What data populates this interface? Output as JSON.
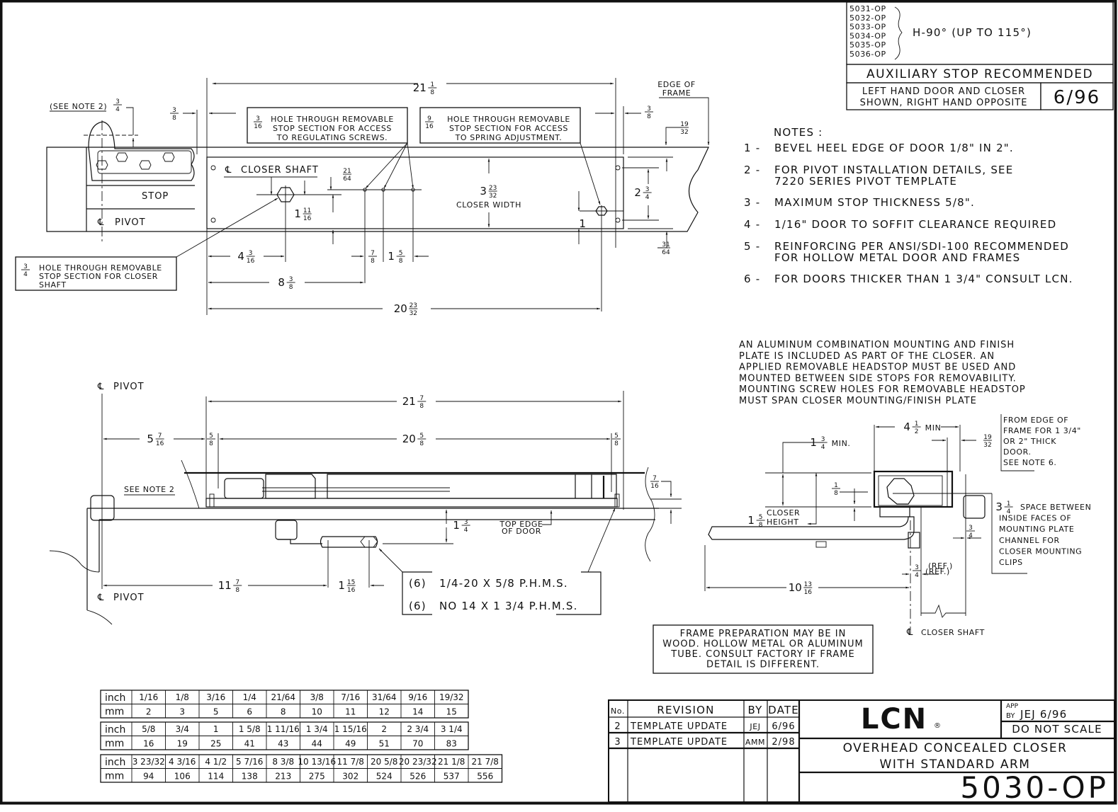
{
  "document": {
    "brand": "LCN",
    "brand_mark": "®",
    "model_number": "5030-OP",
    "title_line1": "OVERHEAD CONCEALED CLOSER",
    "title_line2": "WITH STANDARD ARM",
    "approved_by_label": "APP BY",
    "approved_by_value": "JEJ 6/96",
    "scale_note": "DO NOT SCALE"
  },
  "models_box": {
    "models": [
      "5031-OP",
      "5032-OP",
      "5033-OP",
      "5034-OP",
      "5035-OP",
      "5036-OP"
    ],
    "hold_open": "H-90° (UP TO 115°)",
    "auxiliary": "AUXILIARY STOP RECOMMENDED",
    "hand_note_line1": "LEFT HAND DOOR AND CLOSER",
    "hand_note_line2": "SHOWN, RIGHT HAND OPPOSITE",
    "date": "6/96"
  },
  "notes": {
    "heading": "NOTES :",
    "items": [
      {
        "num": "1 -",
        "lines": [
          "BEVEL HEEL EDGE OF DOOR 1/8\" IN 2\"."
        ]
      },
      {
        "num": "2 -",
        "lines": [
          "FOR PIVOT INSTALLATION DETAILS, SEE",
          "7220 SERIES PIVOT TEMPLATE"
        ]
      },
      {
        "num": "3 -",
        "lines": [
          "MAXIMUM STOP THICKNESS 5/8\"."
        ]
      },
      {
        "num": "4 -",
        "lines": [
          "1/16\" DOOR TO SOFFIT CLEARANCE REQUIRED"
        ]
      },
      {
        "num": "5 -",
        "lines": [
          "REINFORCING PER ANSI/SDI-100 RECOMMENDED",
          "FOR HOLLOW METAL DOOR AND FRAMES"
        ]
      },
      {
        "num": "6 -",
        "lines": [
          "FOR DOORS THICKER THAN 1 3/4\" CONSULT LCN."
        ]
      }
    ]
  },
  "aluminum_note": [
    "AN ALUMINUM COMBINATION MOUNTING AND FINISH",
    "PLATE IS INCLUDED AS PART OF THE CLOSER. AN",
    "APPLIED REMOVABLE HEADSTOP MUST BE USED AND",
    "MOUNTED BETWEEN SIDE STOPS FOR REMOVABILITY.",
    "MOUNTING SCREW HOLES FOR REMOVABLE HEADSTOP",
    "MUST SPAN CLOSER MOUNTING/FINISH PLATE"
  ],
  "frame_prep_note": [
    "FRAME PREPARATION MAY BE IN",
    "WOOD. HOLLOW METAL OR ALUMINUM",
    "TUBE. CONSULT FACTORY IF FRAME",
    "DETAIL IS DIFFERENT."
  ],
  "top_view": {
    "see_note_2": "(SEE NOTE 2)",
    "stop_label": "STOP",
    "pivot_label": "PIVOT",
    "cl_symbol": "℄",
    "closer_shaft_label": "CLOSER SHAFT",
    "closer_width_label": "CLOSER WIDTH",
    "edge_of_frame": [
      "EDGE OF",
      "FRAME"
    ],
    "callout_regulating": {
      "size": "3/16",
      "lines": [
        "HOLE THROUGH REMOVABLE",
        "STOP SECTION FOR ACCESS",
        "TO REGULATING SCREWS."
      ]
    },
    "callout_spring": {
      "size": "9/16",
      "lines": [
        "HOLE THROUGH REMOVABLE",
        "STOP SECTION FOR ACCESS",
        "TO SPRING ADJUSTMENT."
      ]
    },
    "callout_shaft": {
      "size": "3/4",
      "lines": [
        "HOLE THROUGH REMOVABLE",
        "STOP SECTION FOR CLOSER",
        "SHAFT"
      ]
    },
    "dims": {
      "overall_top": {
        "whole": "21",
        "num": "1",
        "den": "8"
      },
      "see_note_dim": {
        "whole": "",
        "num": "3",
        "den": "4"
      },
      "left_offset": {
        "whole": "",
        "num": "3",
        "den": "8"
      },
      "right_offset": {
        "whole": "",
        "num": "3",
        "den": "8"
      },
      "frame_19_32": {
        "whole": "",
        "num": "19",
        "den": "32"
      },
      "hole_21_64": {
        "whole": "",
        "num": "21",
        "den": "64"
      },
      "shaft_height": {
        "whole": "1",
        "num": "11",
        "den": "16"
      },
      "closer_width": {
        "whole": "3",
        "num": "23",
        "den": "32"
      },
      "plate_2_3_4": {
        "whole": "2",
        "num": "3",
        "den": "4"
      },
      "spring_1": {
        "whole": "1",
        "num": "",
        "den": ""
      },
      "frame_31_64": {
        "whole": "",
        "num": "31",
        "den": "64"
      },
      "shaft_4_3_16": {
        "whole": "4",
        "num": "3",
        "den": "16"
      },
      "reg_7_8": {
        "whole": "",
        "num": "7",
        "den": "8"
      },
      "reg_1_5_8": {
        "whole": "1",
        "num": "5",
        "den": "8"
      },
      "reg_8_3_8": {
        "whole": "8",
        "num": "3",
        "den": "8"
      },
      "spring_20_23_32": {
        "whole": "20",
        "num": "23",
        "den": "32"
      }
    }
  },
  "elevation_view": {
    "pivot_label": "PIVOT",
    "see_note_2": "SEE NOTE 2",
    "top_edge_of_door": [
      "TOP EDGE",
      "OF DOOR"
    ],
    "screws": [
      {
        "qty": "(6)",
        "spec": "1/4-20 X 5/8   P.H.M.S."
      },
      {
        "qty": "(6)",
        "spec": "NO 14 X 1 3/4   P.H.M.S."
      }
    ],
    "dims": {
      "overall": {
        "whole": "21",
        "num": "7",
        "den": "8"
      },
      "inner": {
        "whole": "20",
        "num": "5",
        "den": "8"
      },
      "pivot_offset": {
        "whole": "5",
        "num": "7",
        "den": "16"
      },
      "left_5_8": {
        "whole": "",
        "num": "5",
        "den": "8"
      },
      "right_5_8": {
        "whole": "",
        "num": "5",
        "den": "8"
      },
      "clearance_7_16": {
        "whole": "",
        "num": "7",
        "den": "16"
      },
      "arm_drop": {
        "whole": "1",
        "num": "3",
        "den": "4"
      },
      "pivot_to_arm": {
        "whole": "11",
        "num": "7",
        "den": "8"
      },
      "arm_1_15_16": {
        "whole": "1",
        "num": "15",
        "den": "16"
      }
    }
  },
  "section_view": {
    "min_1_3_4": {
      "whole": "1",
      "num": "3",
      "den": "4",
      "suffix": "MIN."
    },
    "min_4_1_2": {
      "whole": "4",
      "num": "1",
      "den": "2",
      "suffix": "MIN"
    },
    "frame_19_32": {
      "whole": "",
      "num": "19",
      "den": "32"
    },
    "frame_note": [
      "FROM EDGE OF",
      "FRAME FOR 1 3/4\"",
      "OR 2\" THICK",
      "DOOR.",
      "SEE NOTE 6."
    ],
    "gap_1_8": {
      "whole": "",
      "num": "1",
      "den": "8"
    },
    "closer_height": {
      "whole": "1",
      "num": "5",
      "den": "8",
      "label1": "CLOSER",
      "label2": "HEIGHT"
    },
    "space_note": {
      "whole": "3",
      "num": "1",
      "den": "4",
      "lines": [
        "SPACE BETWEEN",
        "INSIDE FACES OF",
        "MOUNTING PLATE",
        "CHANNEL FOR",
        "CLOSER MOUNTING",
        "CLIPS"
      ]
    },
    "clip_3_4": {
      "whole": "",
      "num": "3",
      "den": "4"
    },
    "ref_3_4": {
      "whole": "",
      "num": "3",
      "den": "4",
      "suffix": "(REF.)"
    },
    "arm_length": {
      "whole": "10",
      "num": "13",
      "den": "16"
    },
    "closer_shaft_label": "CLOSER SHAFT"
  },
  "conversion_tables": [
    {
      "row_labels": [
        "inch",
        "mm"
      ],
      "inch": [
        "1/16",
        "1/8",
        "3/16",
        "1/4",
        "21/64",
        "3/8",
        "7/16",
        "31/64",
        "9/16",
        "19/32"
      ],
      "mm": [
        "2",
        "3",
        "5",
        "6",
        "8",
        "10",
        "11",
        "12",
        "14",
        "15"
      ]
    },
    {
      "row_labels": [
        "inch",
        "mm"
      ],
      "inch": [
        "5/8",
        "3/4",
        "1",
        "1 5/8",
        "1 11/16",
        "1 3/4",
        "1 15/16",
        "2",
        "2 3/4",
        "3 1/4"
      ],
      "mm": [
        "16",
        "19",
        "25",
        "41",
        "43",
        "44",
        "49",
        "51",
        "70",
        "83"
      ]
    },
    {
      "row_labels": [
        "inch",
        "mm"
      ],
      "inch": [
        "3 23/32",
        "4 3/16",
        "4 1/2",
        "5 7/16",
        "8 3/8",
        "10 13/16",
        "11 7/8",
        "20 5/8",
        "20 23/32",
        "21 1/8",
        "21 7/8"
      ],
      "mm": [
        "94",
        "106",
        "114",
        "138",
        "213",
        "275",
        "302",
        "524",
        "526",
        "537",
        "556"
      ]
    }
  ],
  "revisions": {
    "headers": [
      "No.",
      "REVISION",
      "BY",
      "DATE"
    ],
    "rows": [
      {
        "no": "2",
        "revision": "TEMPLATE UPDATE",
        "by": "JEJ",
        "date": "6/96"
      },
      {
        "no": "3",
        "revision": "TEMPLATE UPDATE",
        "by": "AMM",
        "date": "2/98"
      }
    ]
  }
}
